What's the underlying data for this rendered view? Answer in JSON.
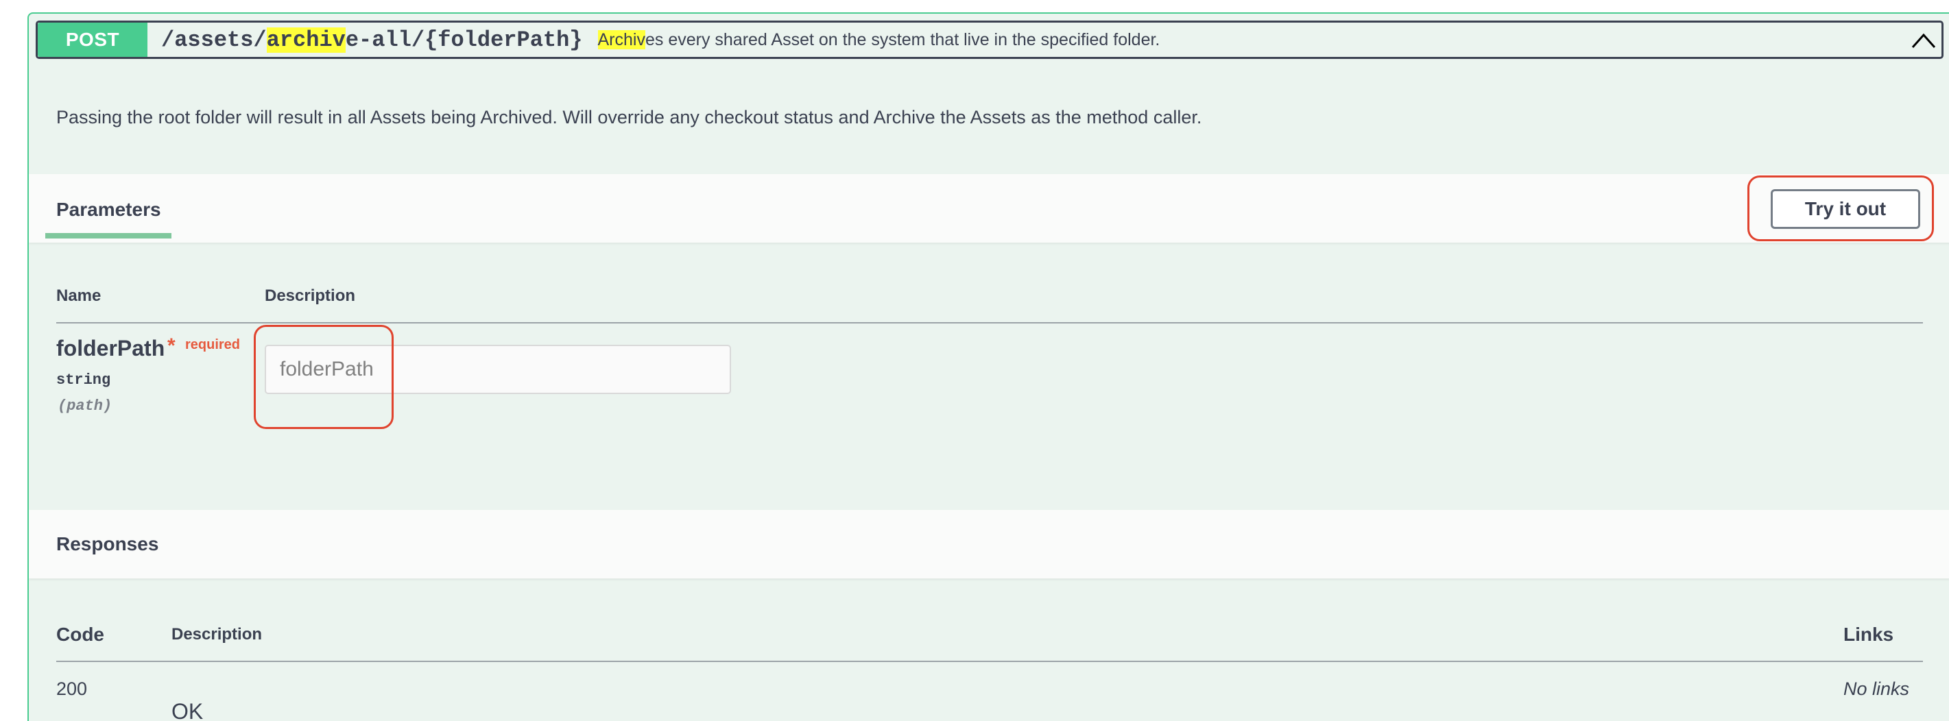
{
  "operation": {
    "method": "POST",
    "path_parts": [
      "/assets/",
      "archiv",
      "e-all/{folderPath}"
    ],
    "summary_parts": [
      "Archiv",
      "es every shared Asset on the system that live in the specified folder."
    ],
    "description": "Passing the root folder will result in all Assets being Archived. Will override any checkout status and Archive the Assets as the method caller."
  },
  "parameters": {
    "tab_label": "Parameters",
    "try_button": "Try it out",
    "col_name": "Name",
    "col_description": "Description",
    "items": [
      {
        "name": "folderPath",
        "required_star": "*",
        "required_text": "required",
        "type": "string",
        "in": "(path)",
        "placeholder": "folderPath"
      }
    ]
  },
  "responses": {
    "label": "Responses",
    "col_code": "Code",
    "col_description": "Description",
    "col_links": "Links",
    "rows": [
      {
        "code": "200",
        "description": "OK",
        "links": "No links"
      }
    ]
  },
  "colors": {
    "post_green": "#49cc90",
    "highlight": "#ffff3a",
    "required": "#e65a3e",
    "annotation_ring": "#e0432e"
  },
  "icons": {
    "collapse": "chevron-up-icon"
  }
}
